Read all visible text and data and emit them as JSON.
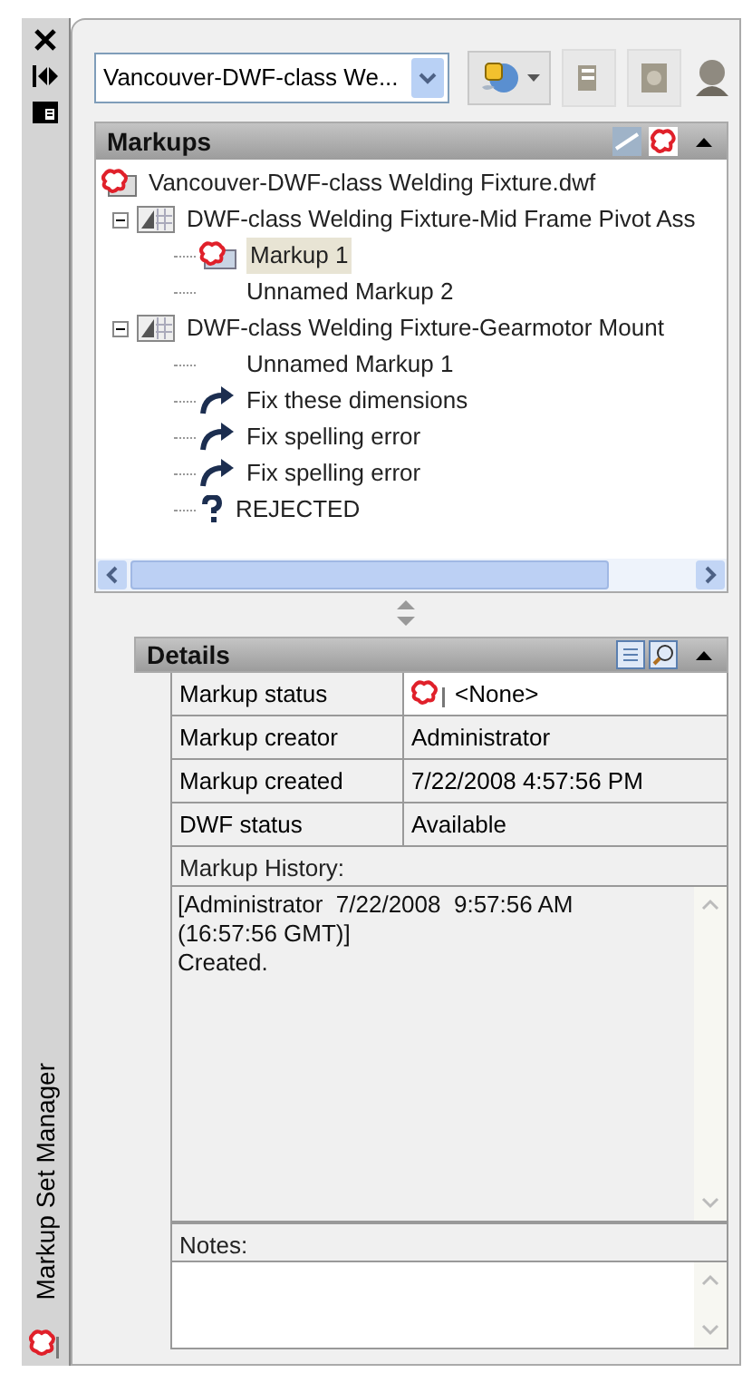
{
  "side_strip": {
    "title": "Markup Set Manager"
  },
  "set_dropdown": {
    "value": "Vancouver-DWF-class We..."
  },
  "markups": {
    "title": "Markups",
    "tree": [
      {
        "label": "Vancouver-DWF-class Welding Fixture.dwf",
        "kind": "file",
        "selected": false,
        "children": [
          {
            "label": "DWF-class Welding Fixture-Mid Frame Pivot Ass",
            "kind": "sheet",
            "expanded": true,
            "selected": false,
            "children": [
              {
                "label": "Markup 1",
                "kind": "markup",
                "selected": true
              },
              {
                "label": "Unnamed Markup 2",
                "kind": "plain",
                "selected": false
              }
            ]
          },
          {
            "label": "DWF-class Welding Fixture-Gearmotor Mount",
            "kind": "sheet",
            "expanded": true,
            "selected": false,
            "children": [
              {
                "label": "Unnamed Markup 1",
                "kind": "plain",
                "selected": false
              },
              {
                "label": "Fix these dimensions",
                "kind": "question",
                "selected": false
              },
              {
                "label": "Fix spelling error",
                "kind": "question",
                "selected": false
              },
              {
                "label": "Fix spelling error",
                "kind": "question",
                "selected": false
              },
              {
                "label": "REJECTED",
                "kind": "rejected",
                "selected": false
              }
            ]
          }
        ]
      }
    ]
  },
  "details": {
    "title": "Details",
    "rows": [
      {
        "label": "Markup status",
        "value": "<None>",
        "kind": "status"
      },
      {
        "label": "Markup creator",
        "value": "Administrator",
        "kind": "text"
      },
      {
        "label": "Markup created",
        "value": "7/22/2008 4:57:56 PM",
        "kind": "text"
      },
      {
        "label": "DWF status",
        "value": "Available",
        "kind": "text"
      }
    ],
    "history": {
      "label": "Markup History:",
      "lines": [
        "[Administrator  7/22/2008  9:57:56 AM",
        "(16:57:56 GMT)]",
        "Created."
      ]
    },
    "notes": {
      "label": "Notes:"
    }
  }
}
